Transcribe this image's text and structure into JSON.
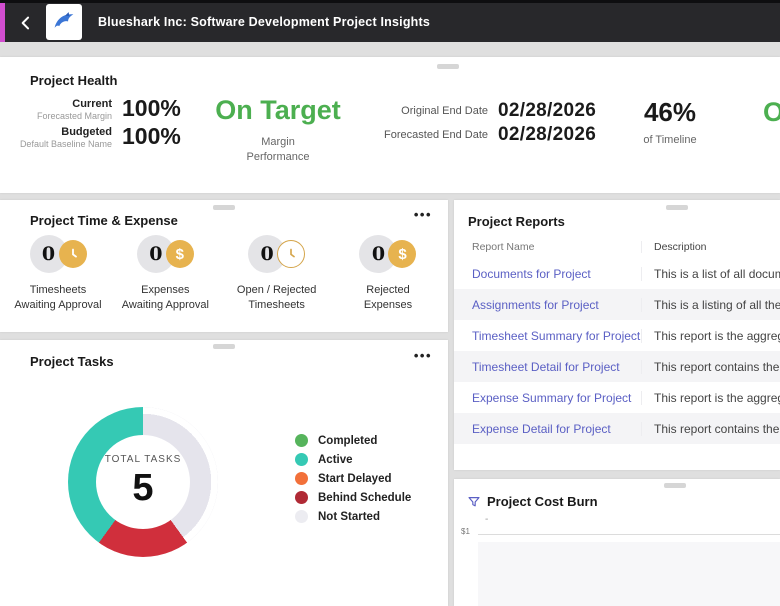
{
  "header": {
    "title": "Blueshark Inc: Software Development Project Insights"
  },
  "project_health": {
    "title": "Project Health",
    "current_label": "Current",
    "current_sublabel": "Forecasted Margin",
    "current_value": "100%",
    "budgeted_label": "Budgeted",
    "budgeted_sublabel": "Default Baseline Name",
    "budgeted_value": "100%",
    "margin_status": "On Target",
    "margin_caption_line1": "Margin",
    "margin_caption_line2": "Performance",
    "original_end_label": "Original End Date",
    "original_end_value": "02/28/2026",
    "forecasted_end_label": "Forecasted End Date",
    "forecasted_end_value": "02/28/2026",
    "timeline_pct": "46%",
    "timeline_caption": "of Timeline",
    "schedule_status_partial": "O"
  },
  "time_expense": {
    "title": "Project Time & Expense",
    "menu": "•••",
    "stats": [
      {
        "value": "0",
        "icon": "clock-filled",
        "label1": "Timesheets",
        "label2": "Awaiting Approval"
      },
      {
        "value": "0",
        "icon": "dollar-filled",
        "label1": "Expenses",
        "label2": "Awaiting Approval"
      },
      {
        "value": "0",
        "icon": "clock-outline",
        "label1": "Open / Rejected",
        "label2": "Timesheets"
      },
      {
        "value": "0",
        "icon": "dollar-filled",
        "label1": "Rejected",
        "label2": "Expenses"
      }
    ]
  },
  "tasks": {
    "title": "Project Tasks",
    "menu": "•••",
    "center_label": "TOTAL TASKS",
    "total": "5",
    "legend": [
      {
        "label": "Completed",
        "color": "#56b45c"
      },
      {
        "label": "Active",
        "color": "#35c9b4"
      },
      {
        "label": "Start Delayed",
        "color": "#f2703a"
      },
      {
        "label": "Behind Schedule",
        "color": "#b02a35"
      },
      {
        "label": "Not Started",
        "color": "#ececf1"
      }
    ]
  },
  "reports": {
    "title": "Project Reports",
    "columns": [
      "Report Name",
      "Description"
    ],
    "rows": [
      {
        "name": "Documents for Project",
        "description": "This is a list of all documents for"
      },
      {
        "name": "Assignments for Project",
        "description": "This is a listing of all the assignm"
      },
      {
        "name": "Timesheet Summary for Project",
        "description": "This report is the aggregate of tim"
      },
      {
        "name": "Timesheet Detail for Project",
        "description": "This report contains the detail bel"
      },
      {
        "name": "Expense Summary for Project",
        "description": "This report is the aggregate of ex"
      },
      {
        "name": "Expense Detail for Project",
        "description": "This report contains the detail bel"
      }
    ]
  },
  "cost_burn": {
    "title": "Project Cost Burn",
    "subtitle": "-",
    "y_tick": "$1"
  },
  "colors": {
    "accent_magenta": "#d24ed0",
    "status_green": "#4caf50",
    "gold": "#e7b34f",
    "link_purple": "#5a5fc4",
    "teal": "#35c9b4",
    "red": "#d02f3c",
    "not_started_gray": "#e5e4ec"
  },
  "chart_data": [
    {
      "type": "pie",
      "title": "Project Tasks",
      "center_label": "TOTAL TASKS",
      "total": 5,
      "legend_position": "right",
      "series": [
        {
          "name": "Completed",
          "value": 0,
          "color": "#56b45c"
        },
        {
          "name": "Active",
          "value": 2,
          "color": "#35c9b4"
        },
        {
          "name": "Start Delayed",
          "value": 0,
          "color": "#f2703a"
        },
        {
          "name": "Behind Schedule",
          "value": 1,
          "color": "#b02a35"
        },
        {
          "name": "Not Started",
          "value": 2,
          "color": "#e5e4ec"
        }
      ]
    },
    {
      "type": "line",
      "title": "Project Cost Burn",
      "ylabel": "",
      "y_ticks": [
        "$1"
      ],
      "note": "chart area mostly cut off at viewport edge; only top gridline visible"
    }
  ]
}
